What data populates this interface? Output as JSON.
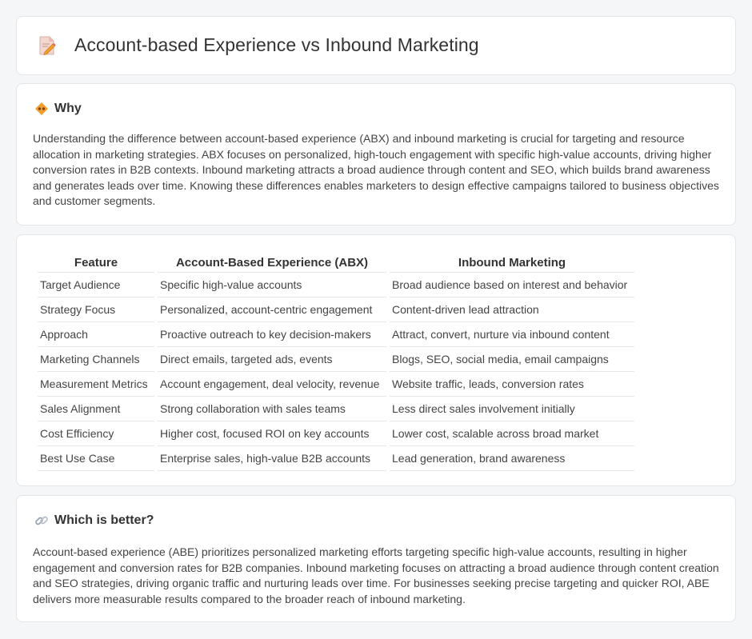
{
  "header": {
    "title": "Account-based Experience vs Inbound Marketing",
    "icon": "document-pencil-icon"
  },
  "why": {
    "icon": "diamond-sign-icon",
    "title": "Why",
    "body": "Understanding the difference between account-based experience (ABX) and inbound marketing is crucial for targeting and resource allocation in marketing strategies. ABX focuses on personalized, high-touch engagement with specific high-value accounts, driving higher conversion rates in B2B contexts. Inbound marketing attracts a broad audience through content and SEO, which builds brand awareness and generates leads over time. Knowing these differences enables marketers to design effective campaigns tailored to business objectives and customer segments."
  },
  "table": {
    "headers": [
      "Feature",
      "Account-Based Experience (ABX)",
      "Inbound Marketing"
    ],
    "rows": [
      [
        "Target Audience",
        "Specific high-value accounts",
        "Broad audience based on interest and behavior"
      ],
      [
        "Strategy Focus",
        "Personalized, account-centric engagement",
        "Content-driven lead attraction"
      ],
      [
        "Approach",
        "Proactive outreach to key decision-makers",
        "Attract, convert, nurture via inbound content"
      ],
      [
        "Marketing Channels",
        "Direct emails, targeted ads, events",
        "Blogs, SEO, social media, email campaigns"
      ],
      [
        "Measurement Metrics",
        "Account engagement, deal velocity, revenue",
        "Website traffic, leads, conversion rates"
      ],
      [
        "Sales Alignment",
        "Strong collaboration with sales teams",
        "Less direct sales involvement initially"
      ],
      [
        "Cost Efficiency",
        "Higher cost, focused ROI on key accounts",
        "Lower cost, scalable across broad market"
      ],
      [
        "Best Use Case",
        "Enterprise sales, high-value B2B accounts",
        "Lead generation, brand awareness"
      ]
    ]
  },
  "better": {
    "icon": "link-icon",
    "title": "Which is better?",
    "body": "Account-based experience (ABE) prioritizes personalized marketing efforts targeting specific high-value accounts, resulting in higher engagement and conversion rates for B2B companies. Inbound marketing focuses on attracting a broad audience through content creation and SEO strategies, driving organic traffic and nurturing leads over time. For businesses seeking precise targeting and quicker ROI, ABE delivers more measurable results compared to the broader reach of inbound marketing."
  },
  "colors": {
    "background": "#f5f6f8",
    "card": "#ffffff",
    "border": "#e3e5e8",
    "accent_orange": "#f0a030"
  }
}
